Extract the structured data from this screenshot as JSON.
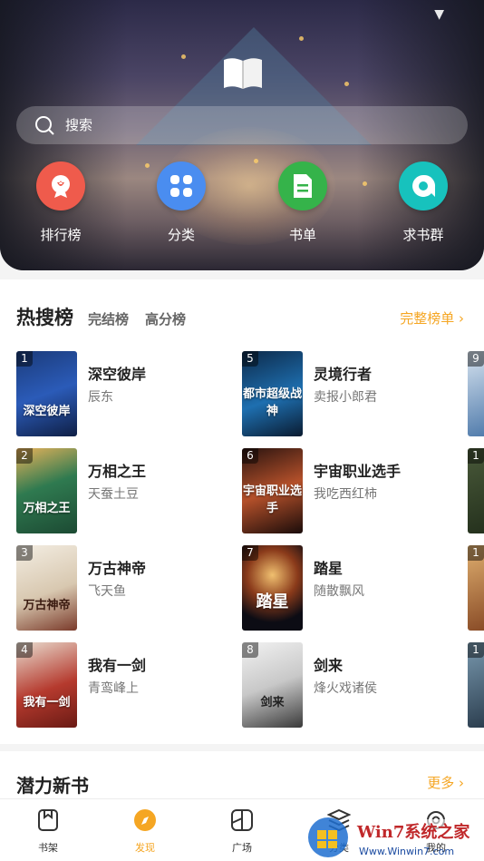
{
  "hero": {
    "search_placeholder": "搜索",
    "quick_links": [
      {
        "label": "排行榜",
        "icon": "ranking-icon",
        "color": "#ef5b4c"
      },
      {
        "label": "分类",
        "icon": "category-icon",
        "color": "#4a8df0"
      },
      {
        "label": "书单",
        "icon": "booklist-icon",
        "color": "#35b34a"
      },
      {
        "label": "求书群",
        "icon": "chat-group-icon",
        "color": "#17c2bd"
      }
    ]
  },
  "hot": {
    "title": "热搜榜",
    "tabs": [
      "完结榜",
      "高分榜"
    ],
    "full_list_label": "完整榜单 ›",
    "books": [
      {
        "rank": "1",
        "title": "深空彼岸",
        "author": "辰东",
        "cover_text": "深空彼岸"
      },
      {
        "rank": "2",
        "title": "万相之王",
        "author": "天蚕土豆",
        "cover_text": "万相之王"
      },
      {
        "rank": "3",
        "title": "万古神帝",
        "author": "飞天鱼",
        "cover_text": "万古神帝"
      },
      {
        "rank": "4",
        "title": "我有一剑",
        "author": "青鸾峰上",
        "cover_text": "我有一剑"
      },
      {
        "rank": "5",
        "title": "灵境行者",
        "author": "卖报小郎君",
        "cover_text": "都市超级战神"
      },
      {
        "rank": "6",
        "title": "宇宙职业选手",
        "author": "我吃西红柿",
        "cover_text": "宇宙职业选手"
      },
      {
        "rank": "7",
        "title": "踏星",
        "author": "随散飘风",
        "cover_text": "踏星"
      },
      {
        "rank": "8",
        "title": "剑来",
        "author": "烽火戏诸侯",
        "cover_text": "剑来"
      }
    ],
    "partial_ranks": [
      "9",
      "1",
      "1",
      "1"
    ]
  },
  "new_books": {
    "title": "潜力新书",
    "more_label": "更多 ›"
  },
  "nav": [
    {
      "label": "书架",
      "icon": "bookshelf-icon"
    },
    {
      "label": "发现",
      "icon": "compass-icon",
      "active": true
    },
    {
      "label": "广场",
      "icon": "square-icon"
    },
    {
      "label": "分类",
      "icon": "layers-icon"
    },
    {
      "label": "我的",
      "icon": "settings-icon"
    }
  ],
  "colors": {
    "accent": "#f5a623"
  }
}
